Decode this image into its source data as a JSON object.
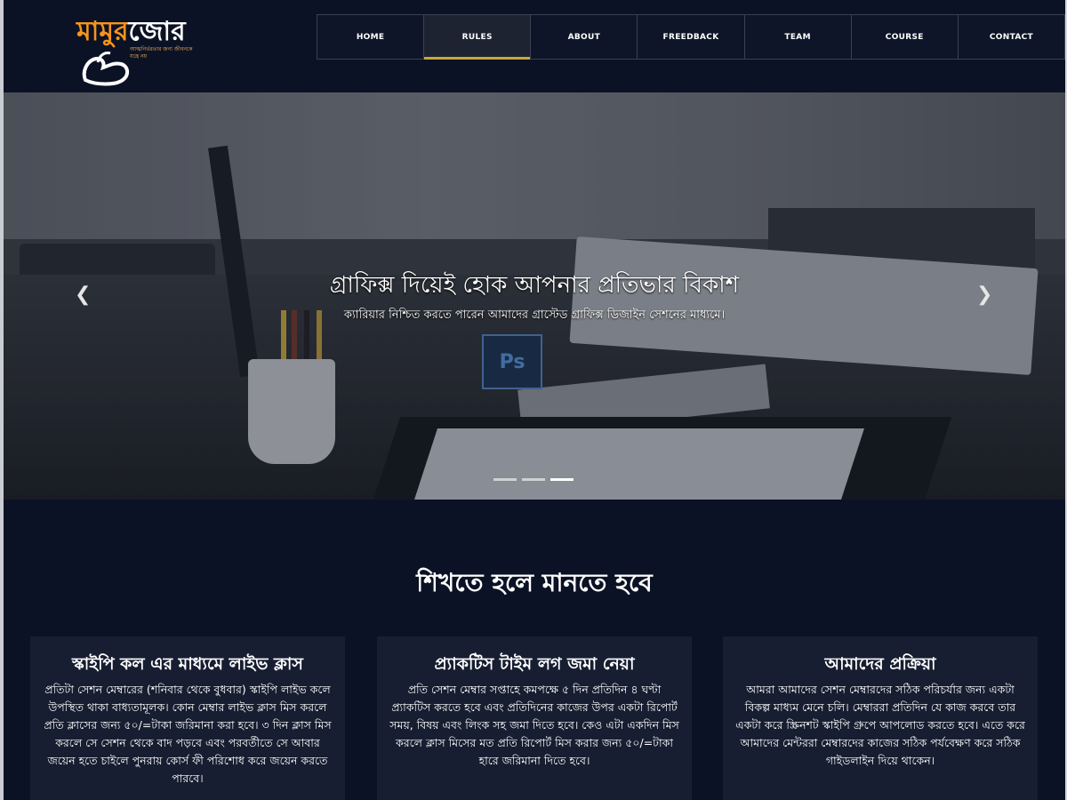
{
  "brand": {
    "logo_part1": "মামুর",
    "logo_part2": "জোর",
    "tagline": "আত্মনির্ভরতার জন্য জীবনকে যন্ত্রে নয়"
  },
  "nav": {
    "items": [
      "HOME",
      "RULES",
      "ABOUT",
      "FREEDBACK",
      "TEAM",
      "COURSE",
      "CONTACT"
    ],
    "active": "RULES"
  },
  "hero": {
    "title": "গ্রাফিক্স দিয়েই হোক আপনার প্রতিভার বিকাশ",
    "subtitle": "ক্যারিয়ার নিশ্চিত করতে পারেন আমাদের গ্রাস্টেড গ্রাফিক্স ডিজাইন সেশনের মাধ্যমে।",
    "image_badge": "Ps",
    "slide_count": 3,
    "active_slide": 3,
    "prev_icon": "chevron-left-icon",
    "next_icon": "chevron-right-icon"
  },
  "rules": {
    "title": "শিখতে হলে মানতে হবে",
    "cards": [
      {
        "title": "স্কাইপি কল এর মাধ্যমে লাইভ ক্লাস",
        "text": "প্রতিটা সেশন মেম্বারের (শনিবার থেকে বুধবার) স্কাইপি লাইভ কলে উপস্থিত থাকা বাধ্যতামূলক। কোন মেম্বার লাইভ ক্লাস মিস করলে প্রতি ক্লাসের জন্য ৫০/=টাকা জরিমানা করা হবে। ৩ দিন ক্লাস মিস করলে সে সেশন থেকে বাদ পড়বে এবং পরবর্তীতে সে আবার জয়েন হতে চাইলে পুনরায় কোর্স ফী পরিশোধ করে জয়েন করতে পারবে।"
      },
      {
        "title": "প্র্যাকটিস টাইম লগ জমা নেয়া",
        "text": "প্রতি সেশন মেম্বার সপ্তাহে কমপক্ষে ৫ দিন প্রতিদিন ৪ ঘণ্টা প্র্যাকটিস করতে হবে এবং প্রতিদিনের কাজের উপর একটা রিপোর্ট সময়, বিষয় এবং লিংক সহ জমা দিতে হবে। কেও এটা একদিন মিস করলে ক্লাস মিসের মত প্রতি রিপোর্ট মিস করার জন্য ৫০/=টাকা হারে জরিমানা দিতে হবে।"
      },
      {
        "title": "আমাদের প্রক্রিয়া",
        "text": "আমরা আমাদের সেশন মেম্বারদের সঠিক পরিচর্যার জন্য একটা বিকল্প মাধ্যম মেনে চলি। মেম্বাররা প্রতিদিন যে কাজ করবে তার একটা করে স্ক্রিনশট স্কাইপি গ্রুপে আপলোড করতে হবে। এতে করে আমাদের মেন্টররা মেম্বারদের কাজের সঠিক পর্যবেক্ষণ করে সঠিক গাইডলাইন দিয়ে থাকেন।"
      }
    ]
  },
  "colors": {
    "background": "#0b1225",
    "card": "#171e31",
    "accent_underline": "#c8a83a",
    "logo_orange": "#f7941d"
  }
}
